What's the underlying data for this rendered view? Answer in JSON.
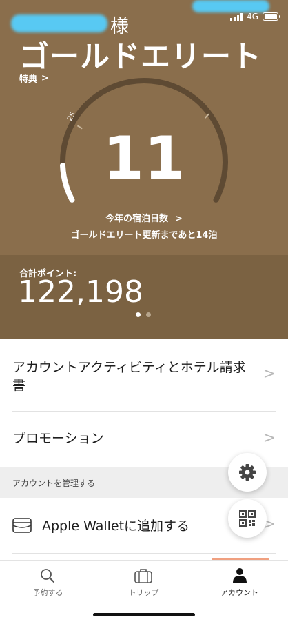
{
  "status_bar": {
    "network": "4G"
  },
  "header": {
    "honorific": "様",
    "tier_title": "ゴールドエリート",
    "benefits_label": "特典",
    "benefits_chevron": ">"
  },
  "gauge": {
    "nights": "11",
    "tick_label": "25",
    "nights_label": "今年の宿泊日数",
    "nights_chevron": ">",
    "renewal_text": "ゴールドエリート更新まであと14泊"
  },
  "points": {
    "label": "合計ポイント:",
    "value": "122,198"
  },
  "list": {
    "activity_label": "アカウントアクティビティとホテル請求書",
    "promotions_label": "プロモーション",
    "section_header": "アカウントを管理する",
    "wallet_label": "Apple Walletに追加する",
    "chevron": ">"
  },
  "tabs": {
    "book_label": "予約する",
    "trips_label": "トリップ",
    "account_label": "アカウント"
  },
  "icons": [
    "settings-gear-icon",
    "qr-code-icon",
    "wallet-card-icon",
    "search-icon",
    "suitcase-icon",
    "person-icon"
  ],
  "colors": {
    "hero_bg": "#8a6e4c",
    "points_band_bg": "#7b6242",
    "gauge_track": "#5e4a33",
    "accent_indicator": "#f0a080"
  }
}
